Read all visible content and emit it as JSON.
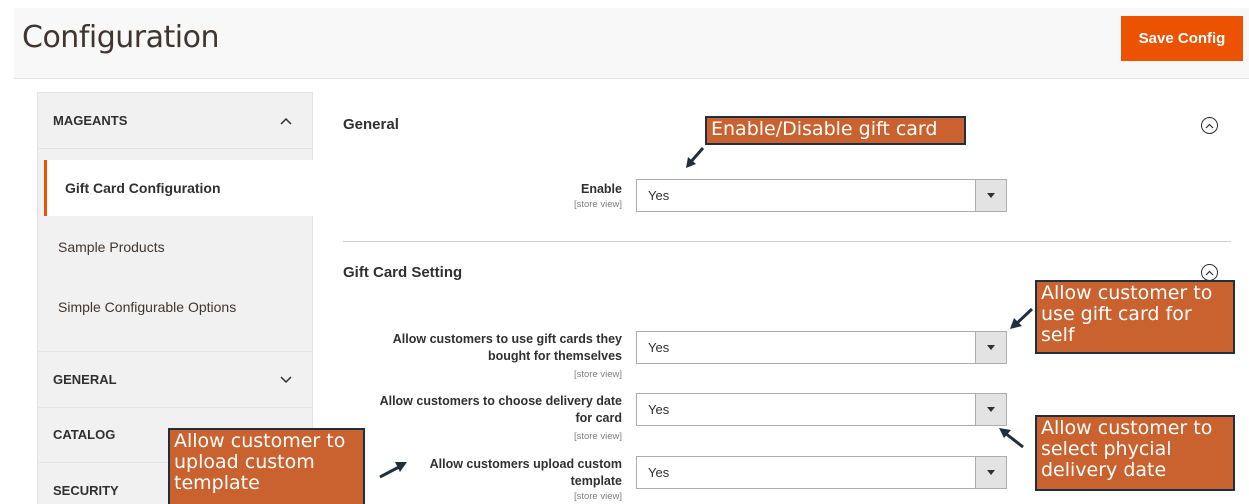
{
  "header": {
    "title": "Configuration",
    "save_label": "Save Config"
  },
  "sidebar": {
    "sections": [
      {
        "label": "MAGEANTS",
        "expanded": true,
        "icon": "chevron-up-icon"
      },
      {
        "label": "GENERAL",
        "expanded": false,
        "icon": "chevron-down-icon"
      },
      {
        "label": "CATALOG",
        "expanded": false,
        "icon": "chevron-down-icon"
      },
      {
        "label": "SECURITY",
        "expanded": false,
        "icon": "chevron-down-icon"
      }
    ],
    "items": [
      {
        "label": "Gift Card Configuration",
        "active": true
      },
      {
        "label": "Sample Products",
        "active": false
      },
      {
        "label": "Simple Configurable Options",
        "active": false
      }
    ]
  },
  "main": {
    "general": {
      "title": "General",
      "fields": [
        {
          "label": "Enable",
          "scope": "[store view]",
          "value": "Yes"
        }
      ]
    },
    "gift_card_setting": {
      "title": "Gift Card Setting",
      "fields": [
        {
          "label_line1": "Allow customers to use gift cards they",
          "label_line2": "bought for themselves",
          "scope": "[store view]",
          "value": "Yes"
        },
        {
          "label_line1": "Allow customers to choose delivery date",
          "label_line2": "for card",
          "scope": "[store view]",
          "value": "Yes"
        },
        {
          "label_line1": "Allow customers upload custom",
          "label_line2": "template",
          "scope": "[store view]",
          "value": "Yes"
        }
      ]
    }
  },
  "annotations": {
    "enable": "Enable/Disable gift card",
    "self_line1": "Allow customer to",
    "self_line2": "use gift card for",
    "self_line3": "self",
    "delivery_line1": "Allow customer to",
    "delivery_line2": "select phycial",
    "delivery_line3": "delivery date",
    "template_line1": "Allow customer to",
    "template_line2": "upload custom",
    "template_line3": "template"
  },
  "colors": {
    "accent": "#eb5202",
    "callout_bg": "#c9622e",
    "callout_border": "#1e3040"
  }
}
